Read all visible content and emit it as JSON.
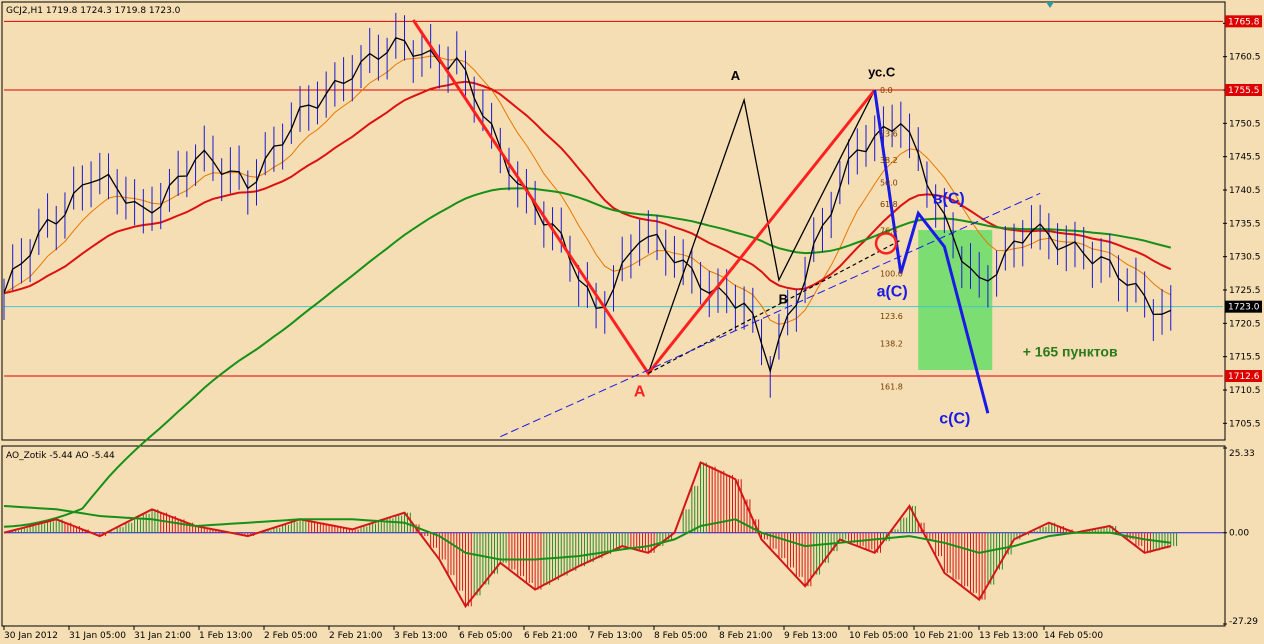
{
  "header": {
    "main": "GCJ2,H1  1719.8 1724.3 1719.8 1723.0",
    "indicator": "AO_Zotik -5.44  AO -5.44"
  },
  "colors": {
    "background": "#f5deb3",
    "price_line": "#000000",
    "ma_fast": "#e87800",
    "ma_mid": "#dd1111",
    "ma_slow": "#169016",
    "wave_red": "#ff2020",
    "wave_blue": "#1a1ae6",
    "profit_zone": "#66dd66",
    "level_line": "#dd0000",
    "current_line": "#44c8d0",
    "histo_up": "#2a8a2a",
    "histo_down": "#d41616"
  },
  "chart_data": [
    {
      "type": "line",
      "symbol": "GCJ2,H1",
      "ohlc": {
        "open": 1719.8,
        "high": 1724.3,
        "low": 1719.8,
        "close": 1723.0
      },
      "ylim": [
        1703.3,
        1768.4
      ],
      "x_ticks": [
        "30 Jan 2012",
        "31 Jan 05:00",
        "31 Jan 21:00",
        "1 Feb 13:00",
        "2 Feb 05:00",
        "2 Feb 21:00",
        "3 Feb 13:00",
        "6 Feb 05:00",
        "6 Feb 21:00",
        "7 Feb 13:00",
        "8 Feb 05:00",
        "8 Feb 21:00",
        "9 Feb 13:00",
        "10 Feb 05:00",
        "10 Feb 21:00",
        "13 Feb 13:00",
        "14 Feb 05:00"
      ],
      "y_ticks": [
        1705.5,
        1710.5,
        1715.5,
        1720.5,
        1725.5,
        1730.5,
        1735.5,
        1740.5,
        1745.5,
        1750.5,
        1755.5,
        1760.5,
        1765.5
      ],
      "price_labels": {
        "level_high": "1765.8",
        "level_mid": "1755.5",
        "current": "1723.0",
        "level_low": "1712.6"
      },
      "levels": {
        "high": 1765.8,
        "mid": 1755.5,
        "current": 1723.0,
        "low": 1712.6
      },
      "price_series": {
        "bars": [
          0,
          5,
          10,
          16,
          22,
          28,
          34,
          40,
          46,
          52,
          57,
          63,
          68,
          73,
          78,
          85,
          88,
          93,
          98,
          103,
          108,
          112,
          118,
          124,
          130,
          134
        ],
        "values": [
          1725,
          1735,
          1743,
          1737,
          1745,
          1742,
          1751,
          1759,
          1762,
          1760,
          1746,
          1735,
          1722,
          1734,
          1729,
          1723,
          1714,
          1732,
          1746,
          1752,
          1735,
          1727,
          1734,
          1732,
          1725,
          1722
        ]
      },
      "wave_points": {
        "red_x": [
          47,
          74,
          100
        ],
        "red_y": [
          1766,
          1713,
          1755.5
        ],
        "blue_x": [
          100,
          103,
          105,
          108,
          113
        ],
        "blue_y": [
          1755.5,
          1728,
          1737,
          1732,
          1707
        ],
        "black_x": [
          74,
          85,
          89,
          100
        ],
        "black_y": [
          1713,
          1754,
          1727,
          1755.5
        ]
      },
      "wave_labels": {
        "red_A": "A",
        "black_A": "A",
        "black_B": "B",
        "top_C": "ус.С",
        "a_C": "а(С)",
        "v_C": "в(С)",
        "c_C": "с(С)",
        "profit": "+ 165 пунктов"
      },
      "fib_labels": [
        "0.0",
        "23.6",
        "38.2",
        "50.0",
        "61.8",
        "76.4",
        "100.0",
        "123.6",
        "138.2",
        "161.8"
      ],
      "fib_values": [
        1755.5,
        1749.0,
        1745.0,
        1741.6,
        1738.4,
        1734.4,
        1728.0,
        1721.6,
        1717.5,
        1711.0
      ]
    },
    {
      "type": "bar",
      "name": "AO_Zotik",
      "ylim": [
        -27.29,
        25.33
      ],
      "y_tick_labels": [
        "25.33",
        "0.00",
        "-27.29"
      ],
      "y_tick_values": [
        25.33,
        0.0,
        -27.29
      ],
      "bars": [
        0,
        6,
        11,
        17,
        22,
        28,
        34,
        40,
        46,
        50,
        53,
        57,
        61,
        66,
        71,
        74,
        77,
        80,
        84,
        87,
        92,
        96,
        100,
        104,
        108,
        112,
        116,
        120,
        123,
        127,
        131,
        134
      ],
      "values": [
        0,
        4,
        -1,
        7,
        2,
        -1,
        4,
        1,
        6,
        -8,
        -22,
        -9,
        -17,
        -10,
        -4,
        -6,
        0,
        21,
        16,
        -2,
        -16,
        -2,
        -6,
        8,
        -12,
        -20,
        -2,
        3,
        0,
        2,
        -6,
        -4
      ],
      "signal": [
        8,
        7,
        5,
        4,
        2,
        3,
        4,
        4,
        3,
        -1,
        -6,
        -8,
        -8,
        -7,
        -5,
        -4,
        -2,
        2,
        4,
        0,
        -4,
        -3,
        -2,
        -1,
        -3,
        -6,
        -4,
        -1,
        0,
        0,
        -2,
        -3
      ]
    }
  ]
}
